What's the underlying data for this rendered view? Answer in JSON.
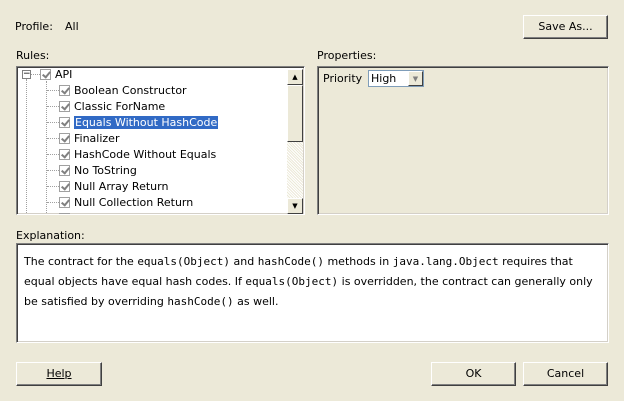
{
  "profile": {
    "label": "Profile:",
    "value": "All"
  },
  "buttons": {
    "save_as": "Save As...",
    "help": "Help",
    "ok": "OK",
    "cancel": "Cancel"
  },
  "rules": {
    "label": "Rules:",
    "root": "API",
    "items": [
      "Boolean Constructor",
      "Classic ForName",
      "Equals Without HashCode",
      "Finalizer",
      "HashCode Without Equals",
      "No ToString",
      "Null Array Return",
      "Null Collection Return",
      "Null ..."
    ],
    "selected_index": 2
  },
  "properties": {
    "label": "Properties:",
    "priority_label": "Priority",
    "priority_value": "High"
  },
  "explanation": {
    "label": "Explanation:",
    "segments": [
      {
        "t": "The contract for the "
      },
      {
        "t": "equals(Object)",
        "code": true
      },
      {
        "t": " and "
      },
      {
        "t": "hashCode()",
        "code": true
      },
      {
        "t": " methods in "
      },
      {
        "t": "java.lang.Object",
        "code": true
      },
      {
        "t": " requires that equal objects have equal hash codes. If "
      },
      {
        "t": "equals(Object)",
        "code": true
      },
      {
        "t": " is overridden, the contract can generally only be satisfied by overriding "
      },
      {
        "t": "hashCode()",
        "code": true
      },
      {
        "t": " as well."
      }
    ]
  }
}
